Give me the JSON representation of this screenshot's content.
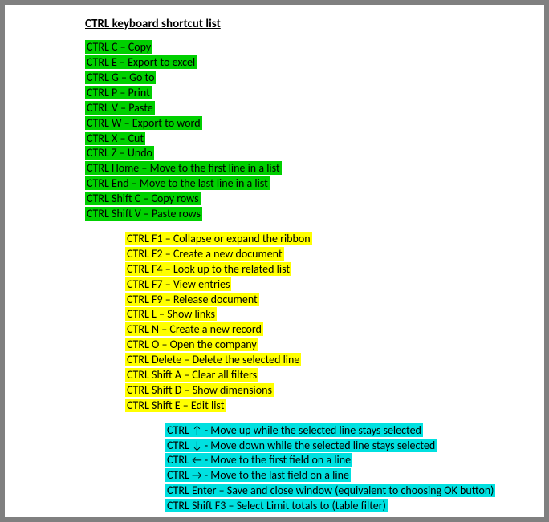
{
  "title": "CTRL keyboard shortcut list",
  "groups": {
    "green": [
      "CTRL C – Copy",
      "CTRL E – Export to excel",
      "CTRL G – Go to",
      "CTRL P – Print",
      "CTRL V – Paste",
      "CTRL W – Export to word",
      "CTRL X – Cut",
      "CTRL Z – Undo",
      "CTRL Home – Move to the first line in a list",
      "CTRL End – Move to the last line in a list",
      "CTRL Shift C – Copy rows",
      "CTRL Shift V – Paste rows"
    ],
    "yellow": [
      "CTRL F1 – Collapse or expand the ribbon",
      "CTRL F2 – Create a new document",
      "CTRL F4 – Look up to the related list",
      "CTRL F7 – View entries",
      "CTRL F9 – Release document",
      "CTRL L – Show links",
      "CTRL N – Create a new record",
      "CTRL O – Open the company",
      "CTRL Delete – Delete the selected line",
      "CTRL Shift A – Clear all filters",
      "CTRL Shift D – Show dimensions",
      "CTRL Shift E – Edit list"
    ],
    "cyan": [
      "CTRL ↑ - Move up while the selected line stays selected",
      "CTRL ↓ - Move down while the selected line stays selected",
      "CTRL ← - Move to the first field on a line",
      "CTRL → - Move to the last field on a line",
      "CTRL Enter – Save and close window (equivalent to choosing OK button)",
      "CTRL Shift F3 – Select Limit totals to (table filter)"
    ]
  }
}
